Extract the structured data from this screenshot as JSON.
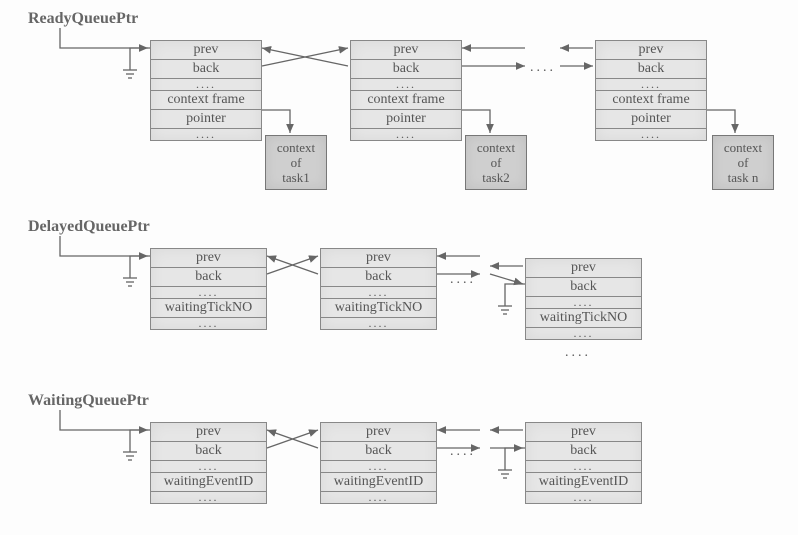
{
  "queues": {
    "ready": {
      "title": "ReadyQueuePtr",
      "nodes": [
        {
          "prev": "prev",
          "back": "back",
          "dots": "....",
          "cfp1": "context frame",
          "cfp2": "pointer",
          "dots2": "....",
          "ctx": "context\nof\ntask1"
        },
        {
          "prev": "prev",
          "back": "back",
          "dots": "....",
          "cfp1": "context frame",
          "cfp2": "pointer",
          "dots2": "....",
          "ctx": "context\nof\ntask2"
        },
        {
          "prev": "prev",
          "back": "back",
          "dots": "....",
          "cfp1": "context frame",
          "cfp2": "pointer",
          "dots2": "....",
          "ctx": "context\nof\ntask n"
        }
      ],
      "ellipsis": "...."
    },
    "delayed": {
      "title": "DelayedQueuePtr",
      "nodes": [
        {
          "prev": "prev",
          "back": "back",
          "dots": "....",
          "field": "waitingTickNO",
          "dots2": "...."
        },
        {
          "prev": "prev",
          "back": "back",
          "dots": "....",
          "field": "waitingTickNO",
          "dots2": "...."
        },
        {
          "prev": "prev",
          "back": "back",
          "dots": "....",
          "field": "waitingTickNO",
          "dots2": "...."
        }
      ],
      "ellipsis": "...."
    },
    "waiting": {
      "title": "WaitingQueuePtr",
      "nodes": [
        {
          "prev": "prev",
          "back": "back",
          "dots": "....",
          "field": "waitingEventID",
          "dots2": "...."
        },
        {
          "prev": "prev",
          "back": "back",
          "dots": "....",
          "field": "waitingEventID",
          "dots2": "...."
        },
        {
          "prev": "prev",
          "back": "back",
          "dots": "....",
          "field": "waitingEventID",
          "dots2": "...."
        }
      ],
      "ellipsis": "...."
    }
  }
}
